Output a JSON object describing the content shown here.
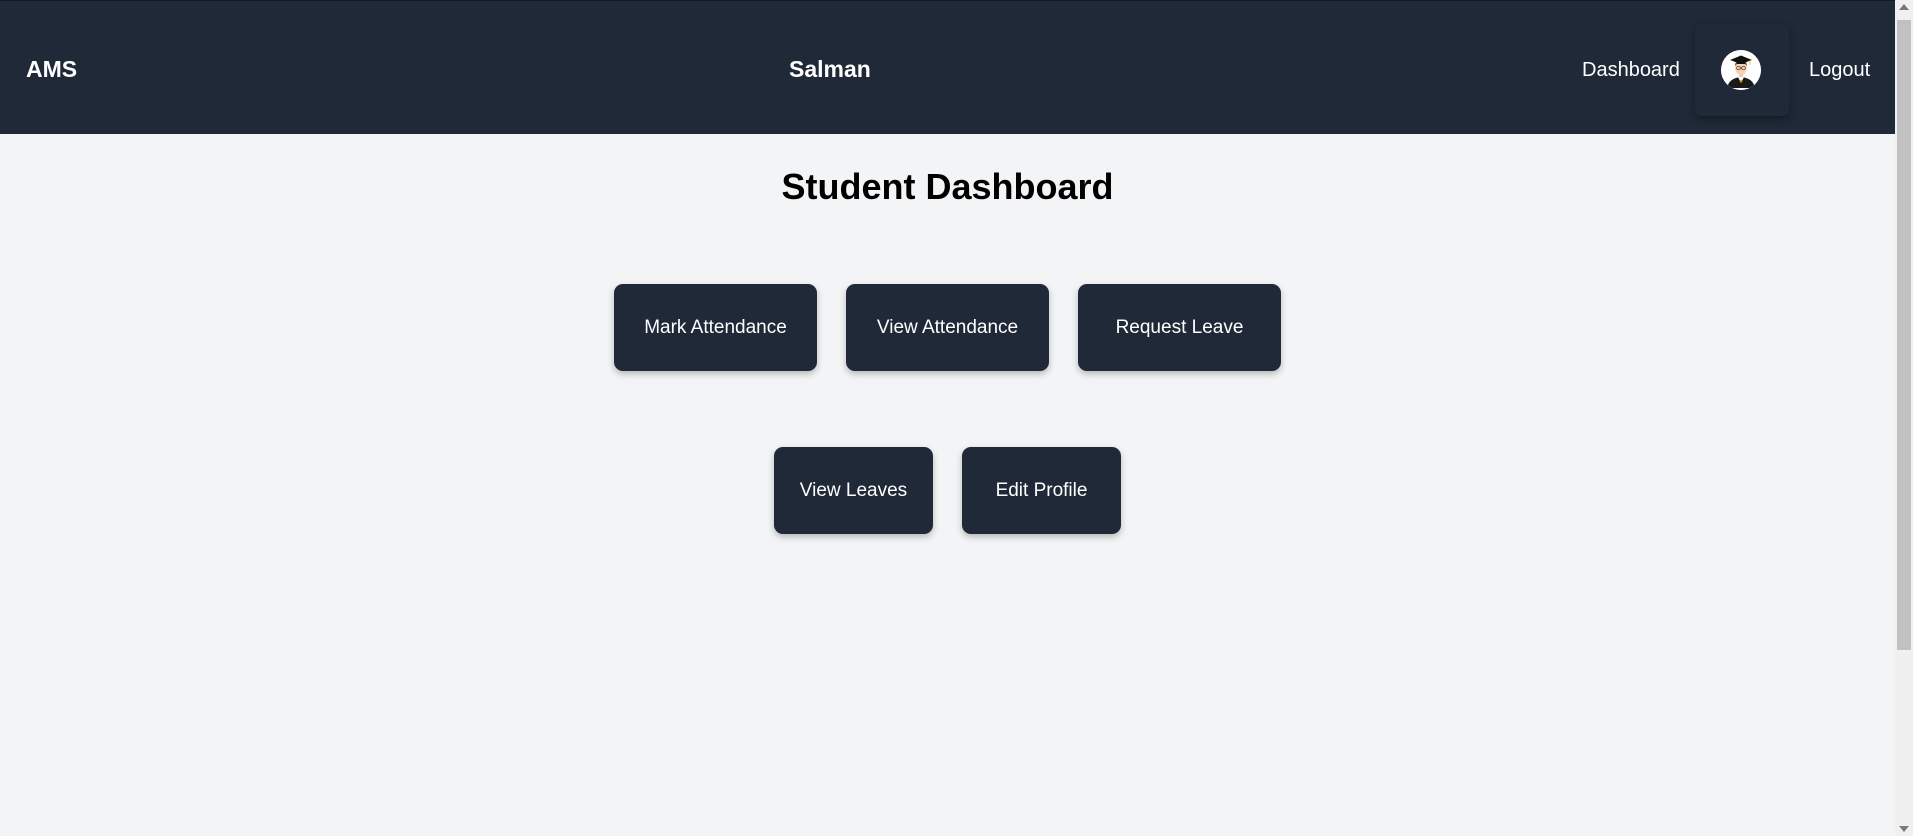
{
  "navbar": {
    "brand": "AMS",
    "username": "Salman",
    "dashboard_link": "Dashboard",
    "logout_link": "Logout",
    "avatar_icon": "student-graduate-avatar-icon",
    "background_color": "#1f2937"
  },
  "main": {
    "title": "Student Dashboard",
    "buttons": [
      {
        "label": "Mark Attendance"
      },
      {
        "label": "View Attendance"
      },
      {
        "label": "Request Leave"
      },
      {
        "label": "View Leaves"
      },
      {
        "label": "Edit Profile"
      }
    ]
  },
  "colors": {
    "accent": "#1f2937",
    "page_background": "#f3f4f6",
    "button_text": "#ffffff"
  }
}
